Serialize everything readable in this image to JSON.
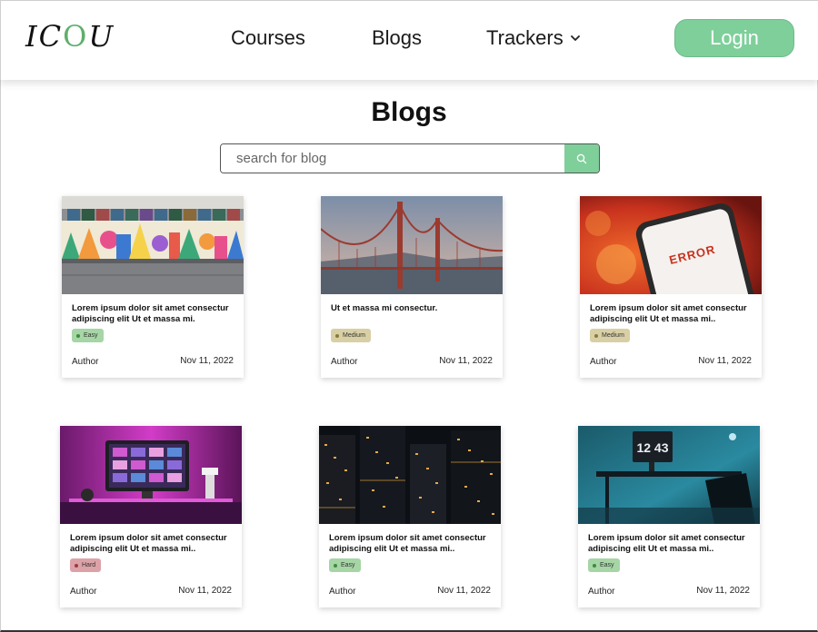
{
  "header": {
    "logo": {
      "left": "IC",
      "o": "O",
      "right": "U"
    },
    "nav": [
      {
        "label": "Courses"
      },
      {
        "label": "Blogs"
      },
      {
        "label": "Trackers"
      }
    ],
    "login_label": "Login"
  },
  "page": {
    "title": "Blogs",
    "search_placeholder": "search for blog"
  },
  "colors": {
    "accent": "#7fcf9b",
    "easy": "#a6d5a6",
    "medium": "#d8cfa5",
    "hard": "#dca2a8"
  },
  "cards": [
    {
      "title": "Lorem ipsum dolor sit amet consectur adipiscing elit Ut et massa mi.",
      "difficulty": "Easy",
      "author": "Author",
      "date": "Nov 11, 2022"
    },
    {
      "title": "Ut et massa mi consectur.",
      "difficulty": "Medium",
      "author": "Author",
      "date": "Nov 11, 2022"
    },
    {
      "title": "Lorem ipsum dolor sit amet consectur adipiscing elit Ut et massa mi..",
      "difficulty": "Medium",
      "author": "Author",
      "date": "Nov 11, 2022"
    },
    {
      "title": "Lorem ipsum dolor sit amet consectur adipiscing elit Ut et massa mi..",
      "difficulty": "Hard",
      "author": "Author",
      "date": "Nov 11, 2022"
    },
    {
      "title": "Lorem ipsum dolor sit amet consectur adipiscing elit Ut et massa mi..",
      "difficulty": "Easy",
      "author": "Author",
      "date": "Nov 11, 2022"
    },
    {
      "title": "Lorem ipsum dolor sit amet consectur adipiscing elit Ut et massa mi..",
      "difficulty": "Easy",
      "author": "Author",
      "date": "Nov 11, 2022"
    }
  ],
  "images": {
    "card_3_text": "ERROR",
    "card_6_text": "12 43"
  }
}
